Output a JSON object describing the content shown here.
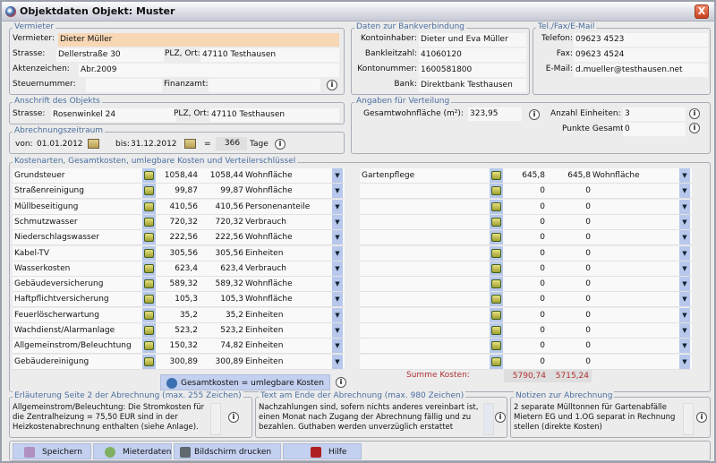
{
  "window": {
    "title": "Objektdaten  Objekt: Muster",
    "close": "X"
  },
  "vermieter": {
    "legend": "Vermieter",
    "vermieter_label": "Vermieter:",
    "vermieter": "Dieter Müller",
    "strasse_label": "Strasse:",
    "strasse": "Dellerstraße 30",
    "plz_label": "PLZ, Ort:",
    "plz": "47110 Testhausen",
    "akten_label": "Aktenzeichen:",
    "akten": "Abr.2009",
    "steuer_label": "Steuernummer:",
    "steuer": "",
    "finanzamt_label": "Finanzamt:",
    "finanzamt": ""
  },
  "bank": {
    "legend": "Daten zur Bankverbindung",
    "inhaber_label": "Kontoinhaber:",
    "inhaber": "Dieter und Eva Müller",
    "blz_label": "Bankleitzahl:",
    "blz": "41060120",
    "konto_label": "Kontonummer:",
    "konto": "1600581800",
    "bank_label": "Bank:",
    "bank": "Direktbank Testhausen"
  },
  "contact": {
    "legend": "Tel./Fax/E-Mail",
    "tel_label": "Telefon:",
    "tel": "09623 4523",
    "fax_label": "Fax:",
    "fax": "09623 4524",
    "mail_label": "E-Mail:",
    "mail": "d.mueller@testhausen.net"
  },
  "objekt": {
    "legend": "Anschrift des Objekts",
    "strasse_label": "Strasse:",
    "strasse": "Rosenwinkel 24",
    "plz_label": "PLZ, Ort:",
    "plz": "47110 Testhausen"
  },
  "zeitraum": {
    "legend": "Abrechnungszeitraum",
    "von_label": "von:",
    "von": "01.01.2012",
    "bis_label": "bis:",
    "bis": "31.12.2012",
    "eq": "=",
    "tage": "366",
    "tage_label": "Tage"
  },
  "verteilung": {
    "legend": "Angaben für Verteilung",
    "flaeche_label": "Gesamtwohnfläche (m²):",
    "flaeche": "323,95",
    "einheiten_label": "Anzahl Einheiten:",
    "einheiten": "3",
    "punkte_label": "Punkte Gesamt:",
    "punkte": "0"
  },
  "kosten": {
    "legend": "Kostenarten, Gesamtkosten, umlegbare Kosten und Verteilerschlüssel",
    "left": [
      [
        "Grundsteuer",
        "1058,44",
        "1058,44",
        "Wohnfläche"
      ],
      [
        "Straßenreinigung",
        "99,87",
        "99,87",
        "Wohnfläche"
      ],
      [
        "Müllbeseitigung",
        "410,56",
        "410,56",
        "Personenanteile"
      ],
      [
        "Schmutzwasser",
        "720,32",
        "720,32",
        "Verbrauch"
      ],
      [
        "Niederschlagswasser",
        "222,56",
        "222,56",
        "Wohnfläche"
      ],
      [
        "Kabel-TV",
        "305,56",
        "305,56",
        "Einheiten"
      ],
      [
        "Wasserkosten",
        "623,4",
        "623,4",
        "Verbrauch"
      ],
      [
        "Gebäudeversicherung",
        "589,32",
        "589,32",
        "Wohnfläche"
      ],
      [
        "Haftpflichtversicherung",
        "105,3",
        "105,3",
        "Wohnfläche"
      ],
      [
        "Feuerlöscherwartung",
        "35,2",
        "35,2",
        "Einheiten"
      ],
      [
        "Wachdienst/Alarmanlage",
        "523,2",
        "523,2",
        "Einheiten"
      ],
      [
        "Allgemeinstrom/Beleuchtung",
        "150,32",
        "74,82",
        "Einheiten"
      ],
      [
        "Gebäudereinigung",
        "300,89",
        "300,89",
        "Einheiten"
      ]
    ],
    "right": [
      [
        "Gartenpflege",
        "645,8",
        "645,8",
        "Wohnfläche"
      ],
      [
        "",
        "0",
        "0",
        ""
      ],
      [
        "",
        "0",
        "0",
        ""
      ],
      [
        "",
        "0",
        "0",
        ""
      ],
      [
        "",
        "0",
        "0",
        ""
      ],
      [
        "",
        "0",
        "0",
        ""
      ],
      [
        "",
        "0",
        "0",
        ""
      ],
      [
        "",
        "0",
        "0",
        ""
      ],
      [
        "",
        "0",
        "0",
        ""
      ],
      [
        "",
        "0",
        "0",
        ""
      ],
      [
        "",
        "0",
        "0",
        ""
      ],
      [
        "",
        "0",
        "0",
        ""
      ],
      [
        "",
        "0",
        "0",
        ""
      ]
    ],
    "gesamt_button": "Gesamtkosten = umlegbare Kosten",
    "summe_label": "Summe Kosten:",
    "summe1": "5790,74",
    "summe2": "5715,24"
  },
  "notes": {
    "erl_legend": "Erläuterung Seite 2 der Abrechnung (max. 255 Zeichen)",
    "erl_text": "Allgemeinstrom/Beleuchtung: Die Stromkosten für die Zentralheizung = 75,50 EUR sind in der Heizkostenabrechnung enthalten (siehe Anlage).",
    "ende_legend": "Text am Ende der Abrechnung (max. 980 Zeichen)",
    "ende_text": "Nachzahlungen sind, sofern nichts anderes vereinbart ist, einen Monat nach Zugang der Abrechnung fällig und zu bezahlen. Guthaben werden unverzüglich erstattet",
    "notiz_legend": "Notizen zur Abrechnung",
    "notiz_text": "2 separate Mülltonnen für Gartenabfälle Mietern EG und 1.OG separat in Rechnung stellen (direkte Kosten)"
  },
  "buttons": {
    "save": "Speichern",
    "mieter": "Mieterdaten",
    "print": "Bildschirm drucken",
    "help": "Hilfe"
  }
}
